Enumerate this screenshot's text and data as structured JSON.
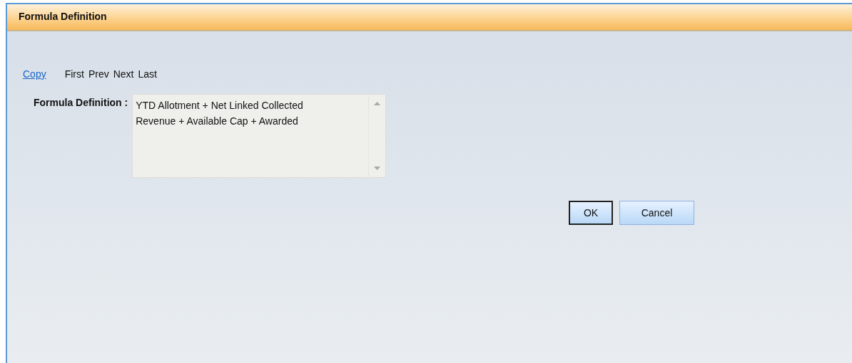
{
  "window": {
    "title": "Formula Definition"
  },
  "nav_links": [
    {
      "label": "Copy",
      "disabled": false
    },
    {
      "label": "First",
      "disabled": true
    },
    {
      "label": "Prev",
      "disabled": true
    },
    {
      "label": "Next",
      "disabled": true
    },
    {
      "label": "Last",
      "disabled": true
    }
  ],
  "formula": {
    "label": "Formula Definition :",
    "value": "YTD Allotment + Net Linked Collected Revenue + Available Cap + Awarded"
  },
  "buttons": [
    {
      "label": "OK",
      "default": true
    },
    {
      "label": "Cancel",
      "default": false
    }
  ]
}
